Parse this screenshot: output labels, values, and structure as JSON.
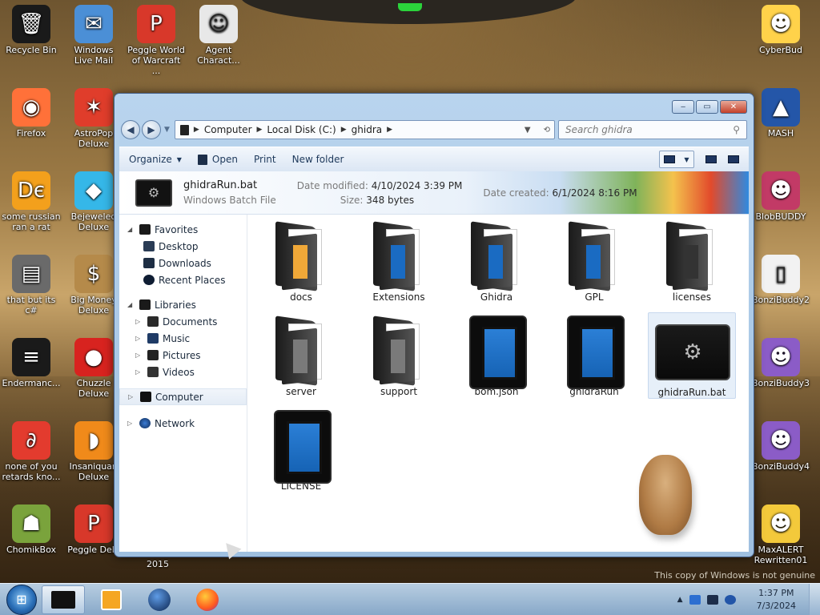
{
  "desktop": {
    "icons_left": [
      {
        "label": "Recycle Bin",
        "icon": "recycle-bin-icon",
        "color": "#1a1a1a"
      },
      {
        "label": "Windows Live Mail",
        "icon": "mail-icon",
        "color": "#4b8fd6"
      },
      {
        "label": "Peggle World of Warcraft ...",
        "icon": "peggle-icon",
        "color": "#d8382a"
      },
      {
        "label": "Agent Charact...",
        "icon": "agent-icon",
        "color": "#e8e8e8"
      },
      {
        "label": "Firefox",
        "icon": "firefox-icon",
        "color": "#ff7139"
      },
      {
        "label": "AstroPop Deluxe",
        "icon": "astropop-icon",
        "color": "#e03d2b"
      },
      {
        "label": "some russian ran a rat",
        "icon": "de-icon",
        "color": "#f3a01c"
      },
      {
        "label": "Bejeweled Deluxe",
        "icon": "gem-icon",
        "color": "#35b7e8"
      },
      {
        "label": "that but its c#",
        "icon": "stack-icon",
        "color": "#6a6a6a"
      },
      {
        "label": "Big Money Deluxe",
        "icon": "money-bag-icon",
        "color": "#b58a4a"
      },
      {
        "label": "Endermanc...",
        "icon": "terminal-icon",
        "color": "#1a1a1a"
      },
      {
        "label": "Chuzzle Deluxe",
        "icon": "chuzzle-icon",
        "color": "#d8231f"
      },
      {
        "label": "none of you retards kno...",
        "icon": "dragon-icon",
        "color": "#e33b2e"
      },
      {
        "label": "Insaniquari Deluxe",
        "icon": "fish-icon",
        "color": "#f08a1a"
      },
      {
        "label": "ChomikBox",
        "icon": "chomikbox-icon",
        "color": "#7aa33c"
      },
      {
        "label": "Peggle Delu",
        "icon": "peggle-icon",
        "color": "#d8382a"
      }
    ],
    "icons_right": [
      {
        "label": "CyberBud",
        "icon": "cyberbud-icon",
        "color": "#ffd24a"
      },
      {
        "label": "MASH",
        "icon": "mash-icon",
        "color": "#2456a8"
      },
      {
        "label": "BlobBUDDY",
        "icon": "blobbuddy-icon",
        "color": "#c23a66"
      },
      {
        "label": "BonziBuddy2",
        "icon": "document-icon",
        "color": "#f2f2f2"
      },
      {
        "label": "BonziBuddy3",
        "icon": "bonzi-icon",
        "color": "#8b5cc7"
      },
      {
        "label": "BonziBuddy4",
        "icon": "bonzi-icon",
        "color": "#8b5cc7"
      },
      {
        "label": "MaxALERT Rewritten01",
        "icon": "maxalert-icon",
        "color": "#f3c93b"
      }
    ],
    "year_label": "2015",
    "watermark": "This copy of Windows is not genuine"
  },
  "window": {
    "controls": {
      "minimize": "‒",
      "maximize": "▭",
      "close": "✕"
    },
    "nav": {
      "back": "◀",
      "forward": "▶"
    },
    "breadcrumb": [
      "Computer",
      "Local Disk (C:)",
      "ghidra"
    ],
    "search_placeholder": "Search ghidra",
    "toolbar": {
      "organize": "Organize",
      "open": "Open",
      "print": "Print",
      "new_folder": "New folder"
    },
    "details": {
      "name": "ghidraRun.bat",
      "type": "Windows Batch File",
      "modified_label": "Date modified:",
      "modified_value": "4/10/2024 3:39 PM",
      "size_label": "Size:",
      "size_value": "348 bytes",
      "created_label": "Date created:",
      "created_value": "6/1/2024 8:16 PM"
    },
    "navpane": {
      "favorites": {
        "label": "Favorites",
        "items": [
          "Desktop",
          "Downloads",
          "Recent Places"
        ]
      },
      "libraries": {
        "label": "Libraries",
        "items": [
          "Documents",
          "Music",
          "Pictures",
          "Videos"
        ]
      },
      "computer": "Computer",
      "network": "Network"
    },
    "items": [
      {
        "name": "docs",
        "kind": "folder",
        "accent": "#f0a838"
      },
      {
        "name": "Extensions",
        "kind": "folder",
        "accent": "#1a6bc2"
      },
      {
        "name": "Ghidra",
        "kind": "folder",
        "accent": "#1a6bc2"
      },
      {
        "name": "GPL",
        "kind": "folder",
        "accent": "#1a6bc2"
      },
      {
        "name": "licenses",
        "kind": "folder",
        "accent": "#333333"
      },
      {
        "name": "server",
        "kind": "folder",
        "accent": "#7a7a7a"
      },
      {
        "name": "support",
        "kind": "folder",
        "accent": "#7a7a7a"
      },
      {
        "name": "bom.json",
        "kind": "file"
      },
      {
        "name": "ghidraRun",
        "kind": "file"
      },
      {
        "name": "ghidraRun.bat",
        "kind": "bat",
        "selected": true
      },
      {
        "name": "LICENSE",
        "kind": "file"
      }
    ]
  },
  "taskbar": {
    "start": "⊞",
    "clock_time": "1:37 PM",
    "clock_date": "7/3/2024",
    "tray_arrow": "▲"
  }
}
